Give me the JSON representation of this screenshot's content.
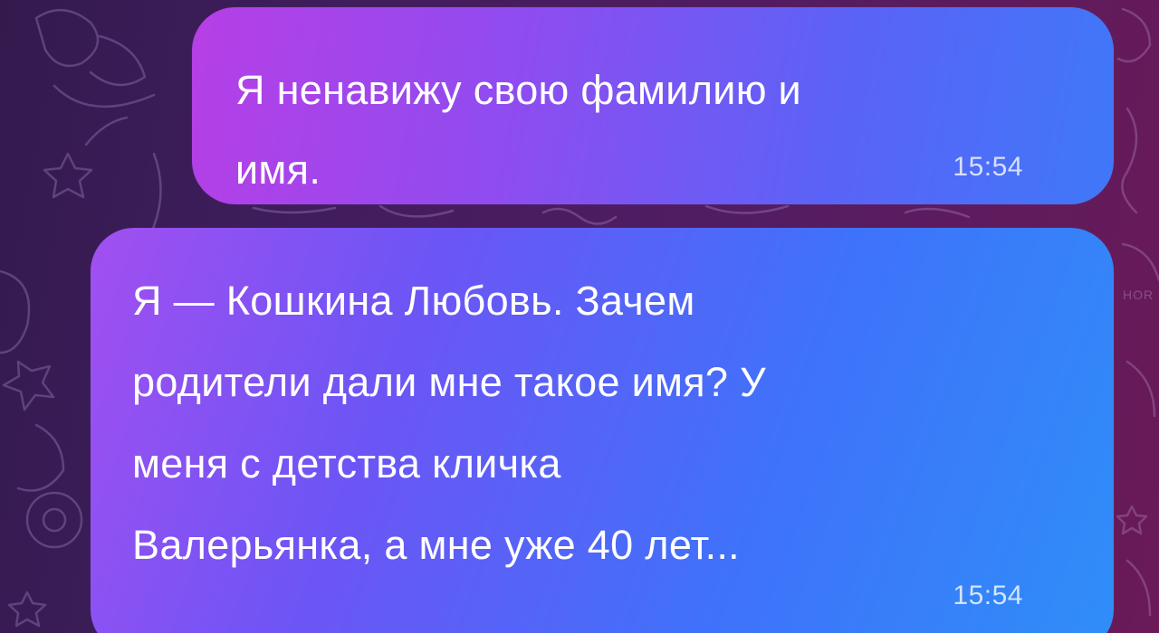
{
  "colors": {
    "background": "#4a1c5e",
    "bubble_gradient_start": "#b63fe6",
    "bubble_gradient_end": "#2f8ef8",
    "text": "#ffffff"
  },
  "messages": [
    {
      "text": "Я ненавижу свою фамилию и\nимя.",
      "time": "15:54",
      "direction": "outgoing"
    },
    {
      "text": "Я — Кошкина Любовь. Зачем\nродители дали мне такое имя? У\nменя с детства кличка\nВалерьянка, а мне уже 40 лет...",
      "time": "15:54",
      "direction": "outgoing"
    }
  ],
  "background_doodles": {
    "visible_text": "HOR"
  }
}
